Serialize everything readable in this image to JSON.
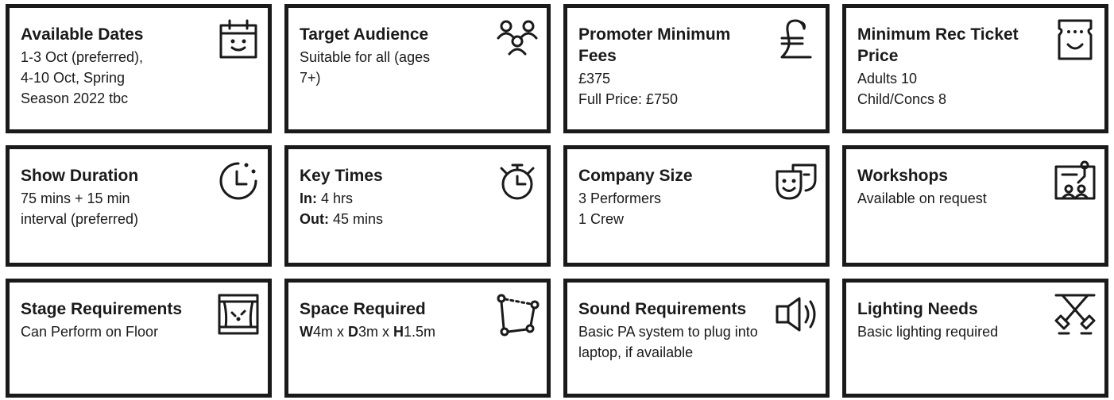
{
  "cards": [
    {
      "title": "Available Dates",
      "icon": "calendar-icon",
      "lines": [
        "1-3 Oct (preferred),",
        "4-10 Oct, Spring",
        "Season 2022 tbc"
      ]
    },
    {
      "title": "Target Audience",
      "icon": "audience-icon",
      "lines": [
        "Suitable for all (ages",
        "7+)"
      ]
    },
    {
      "title": "Promoter Minimum Fees",
      "icon": "pound-icon",
      "lines": [
        "£375",
        "Full Price: £750"
      ]
    },
    {
      "title": "Minimum Rec Ticket Price",
      "icon": "ticket-icon",
      "lines": [
        "Adults 10",
        "Child/Concs 8"
      ]
    },
    {
      "title": "Show Duration",
      "icon": "clock-icon",
      "lines": [
        "75 mins + 15 min",
        "interval (preferred)"
      ]
    },
    {
      "title": "Key Times",
      "icon": "stopwatch-icon",
      "lines": [
        {
          "label": "In:",
          "value": " 4 hrs"
        },
        {
          "label": "Out:",
          "value": " 45 mins"
        }
      ]
    },
    {
      "title": "Company Size",
      "icon": "theatre-mask-icon",
      "lines": [
        "3 Performers",
        "1 Crew"
      ]
    },
    {
      "title": "Workshops",
      "icon": "workshop-icon",
      "lines": [
        "Available on request"
      ]
    },
    {
      "title": "Stage Requirements",
      "icon": "stage-icon",
      "lines": [
        "Can Perform on Floor"
      ]
    },
    {
      "title": "Space Required",
      "icon": "space-icon",
      "lines": [
        {
          "parts": [
            {
              "b": "W"
            },
            {
              "t": "4m x "
            },
            {
              "b": "D"
            },
            {
              "t": "3m x "
            },
            {
              "b": "H"
            },
            {
              "t": "1.5m"
            }
          ]
        }
      ]
    },
    {
      "title": "Sound Requirements",
      "icon": "speaker-icon",
      "lines": [
        "Basic PA system to plug into",
        "laptop, if available"
      ]
    },
    {
      "title": "Lighting Needs",
      "icon": "spotlight-icon",
      "lines": [
        "Basic lighting required"
      ]
    }
  ]
}
